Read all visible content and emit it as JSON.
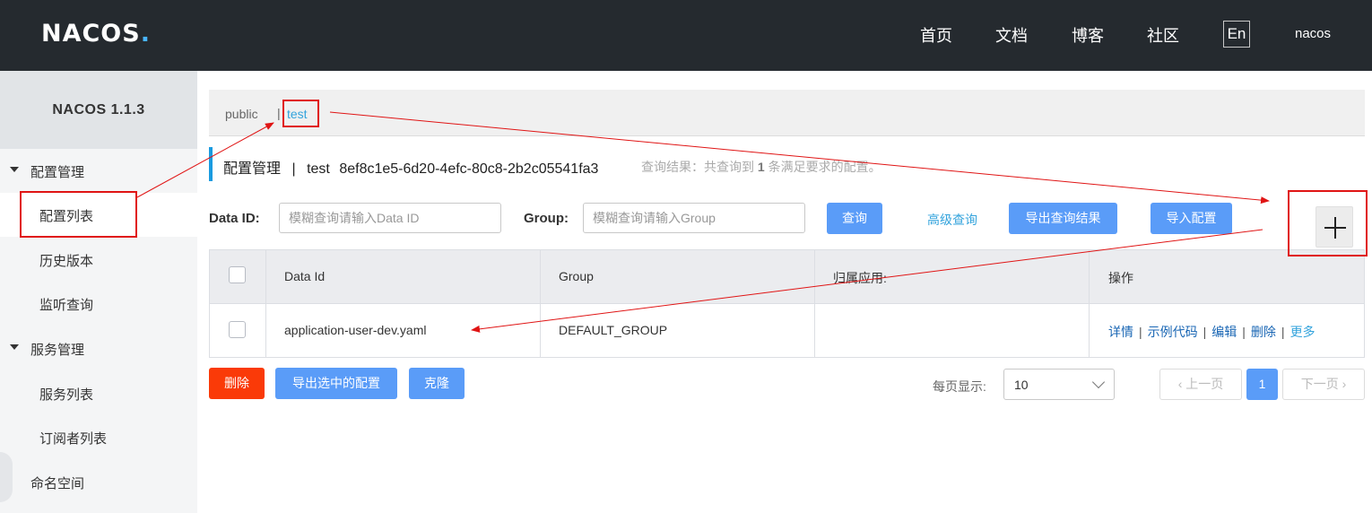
{
  "header": {
    "logo": "NACOS",
    "logo_dot": ".",
    "nav": [
      "首页",
      "文档",
      "博客",
      "社区"
    ],
    "lang": "En",
    "user": "nacos"
  },
  "sidebar": {
    "version": "NACOS 1.1.3",
    "groups": [
      {
        "label": "配置管理",
        "items": [
          "配置列表",
          "历史版本",
          "监听查询"
        ]
      },
      {
        "label": "服务管理",
        "items": [
          "服务列表",
          "订阅者列表"
        ]
      }
    ],
    "extra": "命名空间",
    "active_item": "配置列表"
  },
  "namespaces": {
    "items": [
      "public",
      "test"
    ],
    "separator": "|",
    "selected": "test"
  },
  "page_title": {
    "section": "配置管理",
    "divider": "|",
    "namespace": "test",
    "namespace_id": "8ef8c1e5-6d20-4efc-80c8-2b2c05541fa3",
    "summary_prefix": "查询结果：共查询到",
    "summary_count": "1",
    "summary_suffix": "条满足要求的配置。"
  },
  "search": {
    "data_id_label": "Data ID:",
    "data_id_placeholder": "模糊查询请输入Data ID",
    "group_label": "Group:",
    "group_placeholder": "模糊查询请输入Group",
    "query_button": "查询",
    "advanced_link": "高级查询",
    "export_results_button": "导出查询结果",
    "import_button": "导入配置"
  },
  "table": {
    "columns": [
      "Data Id",
      "Group",
      "归属应用:",
      "操作"
    ],
    "rows": [
      {
        "data_id": "application-user-dev.yaml",
        "group": "DEFAULT_GROUP",
        "app": "",
        "ops": [
          "详情",
          "示例代码",
          "编辑",
          "删除",
          "更多"
        ]
      }
    ]
  },
  "bottom": {
    "delete_button": "删除",
    "export_selected_button": "导出选中的配置",
    "clone_button": "克隆",
    "page_size_label": "每页显示:",
    "page_size": "10",
    "prev_button": "上一页",
    "current_page": "1",
    "next_button": "下一页"
  },
  "colors": {
    "header_bg": "#252a2f",
    "primary": "#5a9cf8",
    "danger": "#fa3a08",
    "link": "#33a3dc",
    "annotation": "#e01414"
  },
  "icons": [
    "plus-icon",
    "caret-down-icon",
    "chevron-down-icon",
    "chevron-left-icon",
    "chevron-right-icon"
  ]
}
